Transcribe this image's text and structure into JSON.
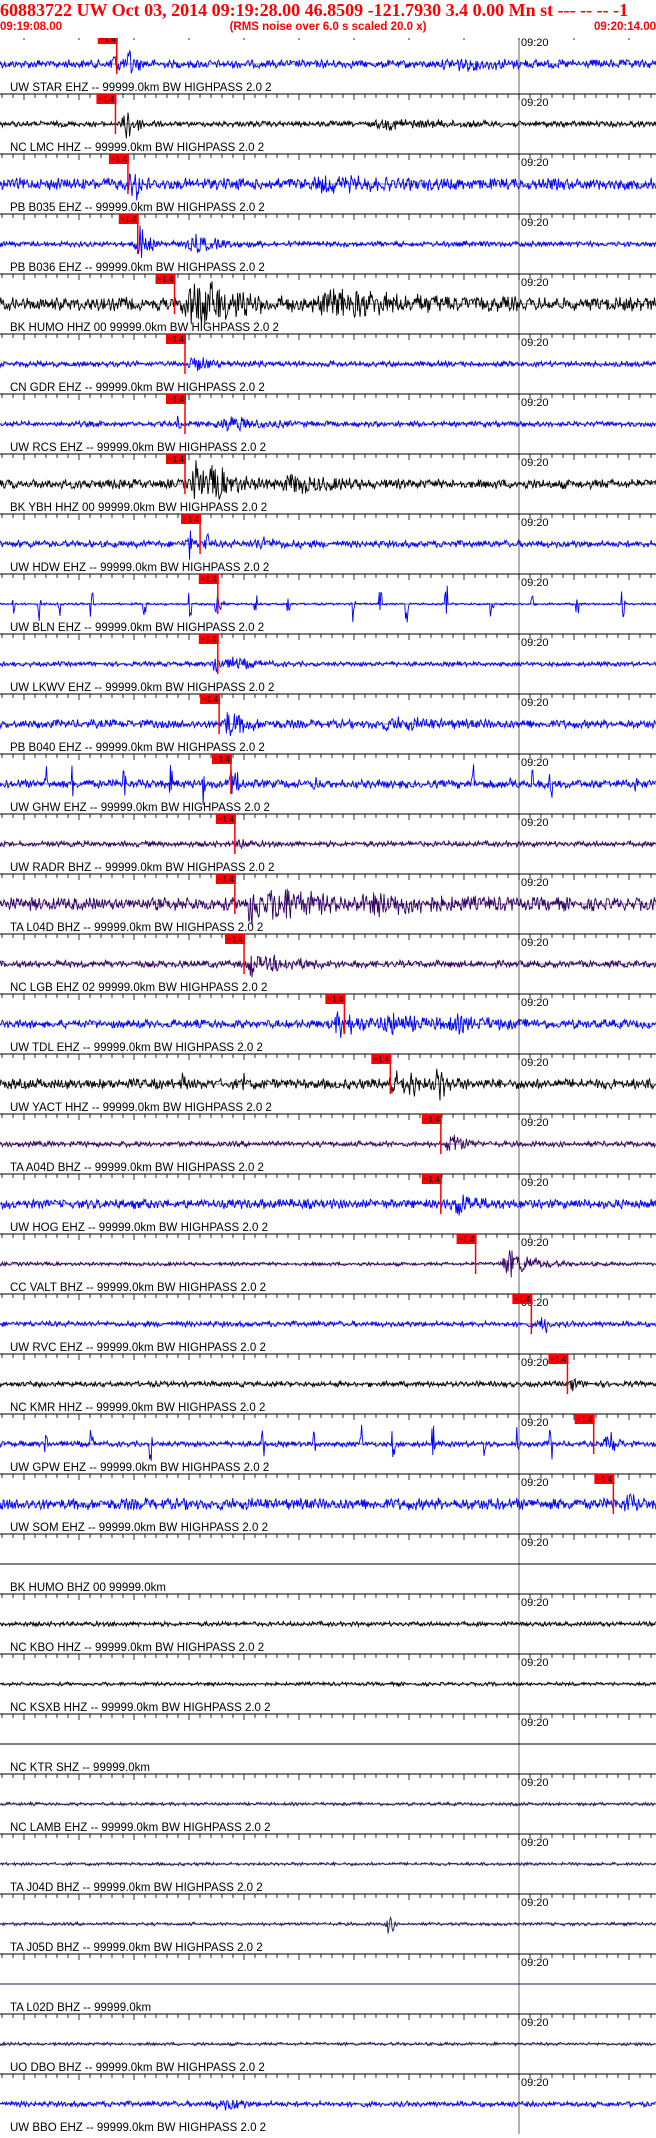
{
  "header": {
    "title": "60883722 UW Oct 03, 2014 09:19:28.00   46.8509 -121.7930  3.4 0.00 Mn st --- -- --   -1",
    "start_time": "09:19:08.00",
    "rms_note": "(RMS noise over 6.0 s scaled 20.0 x)",
    "end_time": "09:20:14.00"
  },
  "colors": {
    "header": "#ff0000",
    "blue": "#0000ff",
    "black": "#000000",
    "navy": "#1a1a66",
    "purple": "#330066",
    "pick": "#ff0000"
  },
  "chart_data": {
    "type": "line",
    "time_axis": {
      "start_time": "09:19:08.00",
      "end_time": "09:20:14.00",
      "tick_label": "09:20"
    },
    "pick_label": "~1.4",
    "traces": [
      {
        "label": "UW STAR EHZ -- 99999.0km BW  HIGHPASS  2.0  2",
        "color": "blue",
        "pick": 0.178,
        "onset": 0.165,
        "env": [
          [
            0.174,
            5,
            0.6
          ],
          [
            0.2,
            5,
            0.6
          ],
          [
            0.7,
            40,
            0.15
          ]
        ],
        "bg": 0.18,
        "spikes": []
      },
      {
        "label": "NC LMC HHZ -- 99999.0km BW  HIGHPASS  2.0  2",
        "color": "black",
        "pick": 0.176,
        "onset": 0.175,
        "env": [
          [
            0.195,
            8,
            0.75
          ],
          [
            0.6,
            50,
            0.15
          ]
        ],
        "bg": 0.12,
        "spikes": []
      },
      {
        "label": "PB B035 EHZ -- 99999.0km BW  HIGHPASS  2.0  2",
        "color": "blue",
        "pick": 0.195,
        "onset": 0.18,
        "env": [
          [
            0.205,
            6,
            0.7
          ],
          [
            0.5,
            40,
            0.18
          ]
        ],
        "bg": 0.25,
        "spikes": []
      },
      {
        "label": "PB B036 EHZ -- 99999.0km BW  HIGHPASS  2.0  2",
        "color": "blue",
        "pick": 0.21,
        "onset": 0.205,
        "env": [
          [
            0.215,
            8,
            0.75
          ],
          [
            0.3,
            20,
            0.3
          ]
        ],
        "bg": 0.12,
        "spikes": []
      },
      {
        "label": "BK HUMO HHZ 00 99999.0km BW  HIGHPASS  2.0  2",
        "color": "black",
        "pick": 0.266,
        "onset": 0.27,
        "env": [
          [
            0.29,
            10,
            0.9
          ],
          [
            0.32,
            30,
            0.75
          ],
          [
            0.52,
            60,
            0.45
          ]
        ],
        "bg": 0.28,
        "spikes": []
      },
      {
        "label": "CN GDR EHZ -- 99999.0km BW  HIGHPASS  2.0  2",
        "color": "blue",
        "pick": 0.282,
        "onset": 0.278,
        "env": [
          [
            0.3,
            20,
            0.22
          ]
        ],
        "bg": 0.12,
        "spikes": []
      },
      {
        "label": "UW RCS EHZ -- 99999.0km BW  HIGHPASS  2.0  2",
        "color": "blue",
        "pick": 0.282,
        "onset": 0.27,
        "env": [
          [
            0.27,
            2,
            0.5
          ],
          [
            0.35,
            30,
            0.25
          ]
        ],
        "bg": 0.12,
        "spikes": []
      },
      {
        "label": "BK YBH HHZ 00 99999.0km BW  HIGHPASS  2.0  2",
        "color": "black",
        "pick": 0.282,
        "onset": 0.285,
        "env": [
          [
            0.3,
            6,
            0.85
          ],
          [
            0.33,
            20,
            0.65
          ],
          [
            0.45,
            30,
            0.3
          ]
        ],
        "bg": 0.2,
        "spikes": []
      },
      {
        "label": "UW HDW EHZ -- 99999.0km BW  HIGHPASS  2.0  2",
        "color": "blue",
        "pick": 0.305,
        "onset": 0.28,
        "env": [
          [
            0.29,
            2,
            0.65
          ],
          [
            0.315,
            2,
            0.6
          ],
          [
            0.4,
            20,
            0.18
          ]
        ],
        "bg": 0.15,
        "spikes": []
      },
      {
        "label": "UW BLN EHZ -- 99999.0km BW  HIGHPASS  2.0  2",
        "color": "blue",
        "pick": 0.332,
        "onset": 0.33,
        "env": [
          [
            0.335,
            3,
            0.3
          ]
        ],
        "bg": 0.05,
        "spikes": [
          0.02,
          0.06,
          0.09,
          0.14,
          0.22,
          0.29,
          0.33,
          0.39,
          0.44,
          0.54,
          0.58,
          0.62,
          0.68,
          0.75,
          0.81,
          0.88,
          0.95
        ]
      },
      {
        "label": "UW LKWV EHZ -- 99999.0km BW  HIGHPASS  2.0  2",
        "color": "blue",
        "pick": 0.332,
        "onset": 0.3,
        "env": [
          [
            0.33,
            5,
            0.45
          ],
          [
            0.36,
            20,
            0.2
          ]
        ],
        "bg": 0.1,
        "spikes": []
      },
      {
        "label": "PB B040 EHZ -- 99999.0km BW  HIGHPASS  2.0  2",
        "color": "blue",
        "pick": 0.334,
        "onset": 0.33,
        "env": [
          [
            0.35,
            15,
            0.55
          ],
          [
            0.6,
            50,
            0.15
          ]
        ],
        "bg": 0.18,
        "spikes": []
      },
      {
        "label": "UW GHW EHZ -- 99999.0km BW  HIGHPASS  2.0  2",
        "color": "blue",
        "pick": 0.352,
        "onset": 0.34,
        "env": [
          [
            0.355,
            5,
            0.6
          ]
        ],
        "bg": 0.18,
        "spikes": [
          0.07,
          0.11,
          0.19,
          0.26,
          0.31,
          0.36,
          0.48,
          0.72,
          0.78,
          0.81,
          0.84,
          0.97
        ]
      },
      {
        "label": "UW RADR BHZ -- 99999.0km BW  HIGHPASS  2.0  2",
        "color": "purple",
        "pick": 0.358,
        "onset": 0.35,
        "env": [
          [
            0.37,
            5,
            0.2
          ]
        ],
        "bg": 0.12,
        "spikes": []
      },
      {
        "label": "TA L04D BHZ -- 99999.0km BW  HIGHPASS  2.0  2",
        "color": "purple",
        "pick": 0.358,
        "onset": 0.37,
        "env": [
          [
            0.385,
            8,
            0.95
          ],
          [
            0.43,
            30,
            0.6
          ],
          [
            0.58,
            60,
            0.25
          ]
        ],
        "bg": 0.28,
        "spikes": []
      },
      {
        "label": "NC LGB EHZ 02 99999.0km BW  HIGHPASS  2.0  2",
        "color": "purple",
        "pick": 0.372,
        "onset": 0.37,
        "env": [
          [
            0.385,
            5,
            0.55
          ],
          [
            0.42,
            30,
            0.25
          ]
        ],
        "bg": 0.15,
        "spikes": []
      },
      {
        "label": "UW TDL EHZ -- 99999.0km BW  HIGHPASS  2.0  2",
        "color": "blue",
        "pick": 0.525,
        "onset": 0.46,
        "env": [
          [
            0.52,
            20,
            0.4
          ],
          [
            0.6,
            30,
            0.35
          ],
          [
            0.7,
            40,
            0.2
          ]
        ],
        "bg": 0.18,
        "spikes": []
      },
      {
        "label": "UW YACT HHZ -- 99999.0km BW  HIGHPASS  2.0  2",
        "color": "black",
        "pick": 0.595,
        "onset": 0.55,
        "env": [
          [
            0.6,
            8,
            0.5
          ],
          [
            0.625,
            6,
            0.65
          ],
          [
            0.67,
            6,
            0.7
          ]
        ],
        "bg": 0.22,
        "spikes": [
          0.28,
          0.37
        ]
      },
      {
        "label": "TA A04D BHZ -- 99999.0km BW  HIGHPASS  2.0  2",
        "color": "purple",
        "pick": 0.672,
        "onset": 0.66,
        "env": [
          [
            0.69,
            10,
            0.45
          ]
        ],
        "bg": 0.12,
        "spikes": []
      },
      {
        "label": "UW HOG EHZ -- 99999.0km BW  HIGHPASS  2.0  2",
        "color": "blue",
        "pick": 0.672,
        "onset": 0.66,
        "env": [
          [
            0.7,
            15,
            0.35
          ]
        ],
        "bg": 0.2,
        "spikes": []
      },
      {
        "label": "CC VALT BHZ -- 99999.0km BW  HIGHPASS  2.0  2",
        "color": "purple",
        "pick": 0.725,
        "onset": 0.72,
        "env": [
          [
            0.78,
            20,
            0.6
          ]
        ],
        "bg": 0.08,
        "spikes": []
      },
      {
        "label": "UW RVC EHZ -- 99999.0km BW  HIGHPASS  2.0  2",
        "color": "blue",
        "pick": 0.81,
        "onset": 0.8,
        "env": [
          [
            0.83,
            5,
            0.4
          ]
        ],
        "bg": 0.12,
        "spikes": []
      },
      {
        "label": "NC KMR HHZ -- 99999.0km BW  HIGHPASS  2.0  2",
        "color": "black",
        "pick": 0.865,
        "onset": 0.85,
        "env": [
          [
            0.875,
            4,
            0.35
          ]
        ],
        "bg": 0.12,
        "spikes": []
      },
      {
        "label": "UW GPW EHZ -- 99999.0km BW  HIGHPASS  2.0  2",
        "color": "blue",
        "pick": 0.905,
        "onset": 0.91,
        "env": [
          [
            0.93,
            6,
            0.5
          ]
        ],
        "bg": 0.12,
        "spikes": [
          0.07,
          0.14,
          0.23,
          0.4,
          0.48,
          0.55,
          0.6,
          0.66,
          0.74,
          0.79,
          0.84
        ]
      },
      {
        "label": "UW SOM EHZ -- 99999.0km BW  HIGHPASS  2.0  2",
        "color": "blue",
        "pick": 0.935,
        "onset": 0.94,
        "env": [
          [
            0.96,
            6,
            0.4
          ]
        ],
        "bg": 0.25,
        "spikes": []
      },
      {
        "label": "BK HUMO BHZ 00 99999.0km",
        "color": "black",
        "pick": null,
        "onset": null,
        "env": [],
        "bg": 0.0,
        "spikes": []
      },
      {
        "label": "NC KBO HHZ -- 99999.0km BW  HIGHPASS  2.0  2",
        "color": "black",
        "pick": null,
        "onset": null,
        "env": [],
        "bg": 0.1,
        "spikes": []
      },
      {
        "label": "NC KSXB HHZ -- 99999.0km BW  HIGHPASS  2.0  2",
        "color": "black",
        "pick": null,
        "onset": null,
        "env": [],
        "bg": 0.08,
        "spikes": []
      },
      {
        "label": "NC KTR SHZ -- 99999.0km",
        "color": "black",
        "pick": null,
        "onset": null,
        "env": [],
        "bg": 0.0,
        "spikes": []
      },
      {
        "label": "NC LAMB EHZ -- 99999.0km BW  HIGHPASS  2.0  2",
        "color": "navy",
        "pick": null,
        "onset": null,
        "env": [],
        "bg": 0.07,
        "spikes": []
      },
      {
        "label": "TA J04D BHZ -- 99999.0km BW  HIGHPASS  2.0  2",
        "color": "navy",
        "pick": null,
        "onset": null,
        "env": [],
        "bg": 0.07,
        "spikes": []
      },
      {
        "label": "TA J05D BHZ -- 99999.0km BW  HIGHPASS  2.0  2",
        "color": "navy",
        "pick": null,
        "onset": null,
        "env": [
          [
            0.595,
            3,
            0.55
          ]
        ],
        "bg": 0.07,
        "spikes": []
      },
      {
        "label": "TA L02D BHZ -- 99999.0km",
        "color": "navy",
        "pick": null,
        "onset": null,
        "env": [],
        "bg": 0.0,
        "spikes": []
      },
      {
        "label": "UO DBO BHZ -- 99999.0km BW  HIGHPASS  2.0  2",
        "color": "navy",
        "pick": null,
        "onset": null,
        "env": [],
        "bg": 0.07,
        "spikes": []
      },
      {
        "label": "UW BBO EHZ -- 99999.0km BW  HIGHPASS  2.0  2",
        "color": "blue",
        "pick": null,
        "onset": null,
        "env": [
          [
            0.35,
            25,
            0.18
          ]
        ],
        "bg": 0.12,
        "spikes": []
      }
    ]
  }
}
